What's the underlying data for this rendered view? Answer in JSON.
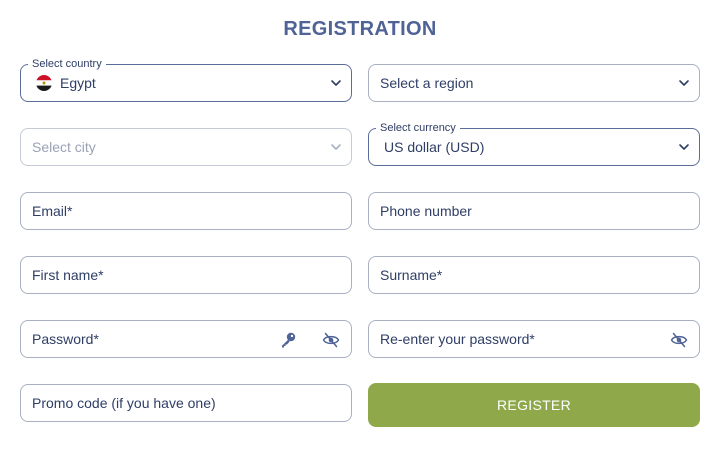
{
  "form": {
    "title": "REGISTRATION",
    "country": {
      "label": "Select country",
      "value": "Egypt"
    },
    "region": {
      "placeholder": "Select a region"
    },
    "city": {
      "placeholder": "Select city"
    },
    "currency": {
      "label": "Select currency",
      "value": "US dollar (USD)"
    },
    "email": {
      "placeholder": "Email*"
    },
    "phone": {
      "placeholder": "Phone number"
    },
    "first_name": {
      "placeholder": "First name*"
    },
    "surname": {
      "placeholder": "Surname*"
    },
    "password": {
      "placeholder": "Password*"
    },
    "password_confirm": {
      "placeholder": "Re-enter your password*"
    },
    "promo": {
      "placeholder": "Promo code (if you have one)"
    },
    "register_label": "REGISTER"
  },
  "icons": {
    "dropdown": "chevron-down-icon",
    "flag": "egypt-flag-icon",
    "generate_password": "key-icon",
    "toggle_visibility": "eye-slash-icon"
  },
  "colors": {
    "title": "#4f6396",
    "text": "#2f3e66",
    "border": "#a9b0c2",
    "muted": "#9aa2b6",
    "register_bg": "#8fa84a"
  }
}
